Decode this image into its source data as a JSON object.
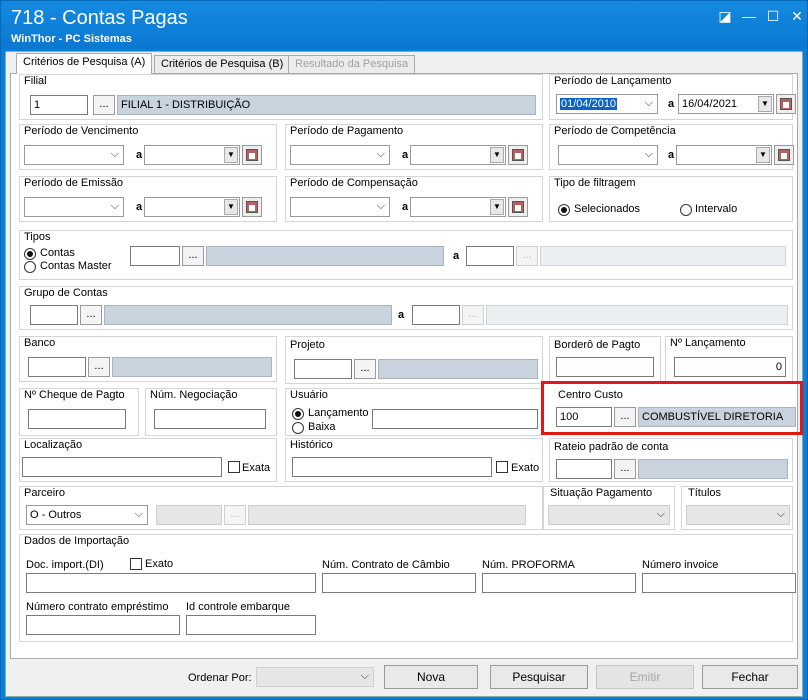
{
  "window": {
    "title": "718 - Contas Pagas",
    "subtitle": "WinThor - PC Sistemas",
    "controls": [
      "◪",
      "—",
      "☐",
      "✕"
    ]
  },
  "tabs": [
    {
      "label": "Critérios de Pesquisa (A)"
    },
    {
      "label": "Critérios de Pesquisa (B)"
    },
    {
      "label": "Resultado da Pesquisa"
    }
  ],
  "filial": {
    "label": "Filial",
    "code": "1",
    "btn": "...",
    "name": "FILIAL 1 - DISTRIBUIÇÃO"
  },
  "lanc": {
    "label": "Período de Lançamento",
    "from": "01/04/2010",
    "to": "16/04/2021",
    "a": "a"
  },
  "venc": {
    "label": "Período de Vencimento",
    "a": "a"
  },
  "pag": {
    "label": "Período de Pagamento",
    "a": "a"
  },
  "comp": {
    "label": "Período de Competência",
    "a": "a"
  },
  "emis": {
    "label": "Período de Emissão",
    "a": "a"
  },
  "compens": {
    "label": "Período de Compensação",
    "a": "a"
  },
  "filtragem": {
    "label": "Tipo de filtragem",
    "opt1": "Selecionados",
    "opt2": "Intervalo"
  },
  "tipos": {
    "label": "Tipos",
    "opt1": "Contas",
    "opt2": "Contas Master",
    "btn": "...",
    "a": "a"
  },
  "grupo": {
    "label": "Grupo de Contas",
    "btn": "...",
    "a": "a"
  },
  "banco": {
    "label": "Banco",
    "btn": "..."
  },
  "projeto": {
    "label": "Projeto",
    "btn": "..."
  },
  "bordero": {
    "label": "Borderô de Pagto"
  },
  "nlanc": {
    "label": "Nº Lançamento",
    "value": "0"
  },
  "cheque": {
    "label": "Nº Cheque de Pagto"
  },
  "negoc": {
    "label": "Núm. Negociação"
  },
  "usuario": {
    "label": "Usuário",
    "opt1": "Lançamento",
    "opt2": "Baixa"
  },
  "ccusto": {
    "label": "Centro Custo",
    "code": "100",
    "btn": "...",
    "name": "COMBUSTÍVEL DIRETORIA"
  },
  "local": {
    "label": "Localização",
    "exato": "Exata"
  },
  "hist": {
    "label": "Histórico",
    "exato": "Exato"
  },
  "rateio": {
    "label": "Rateio padrão de conta",
    "btn": "..."
  },
  "parceiro": {
    "label": "Parceiro",
    "value": "O - Outros",
    "btn": "..."
  },
  "situacao": {
    "label": "Situação Pagamento"
  },
  "titulos": {
    "label": "Títulos"
  },
  "importacao": {
    "label": "Dados de Importação",
    "doc": "Doc. import.(DI)",
    "exato": "Exato",
    "contrato": "Núm. Contrato de Câmbio",
    "proforma": "Núm. PROFORMA",
    "invoice": "Número invoice",
    "emprest": "Número contrato empréstimo",
    "embarque": "Id controle embarque"
  },
  "footer": {
    "ordenar": "Ordenar Por:",
    "nova": "Nova",
    "pesquisar": "Pesquisar",
    "emitir": "Emitir",
    "fechar": "Fechar"
  },
  "accent": "#0a7fd8",
  "highlight": "#e01818"
}
